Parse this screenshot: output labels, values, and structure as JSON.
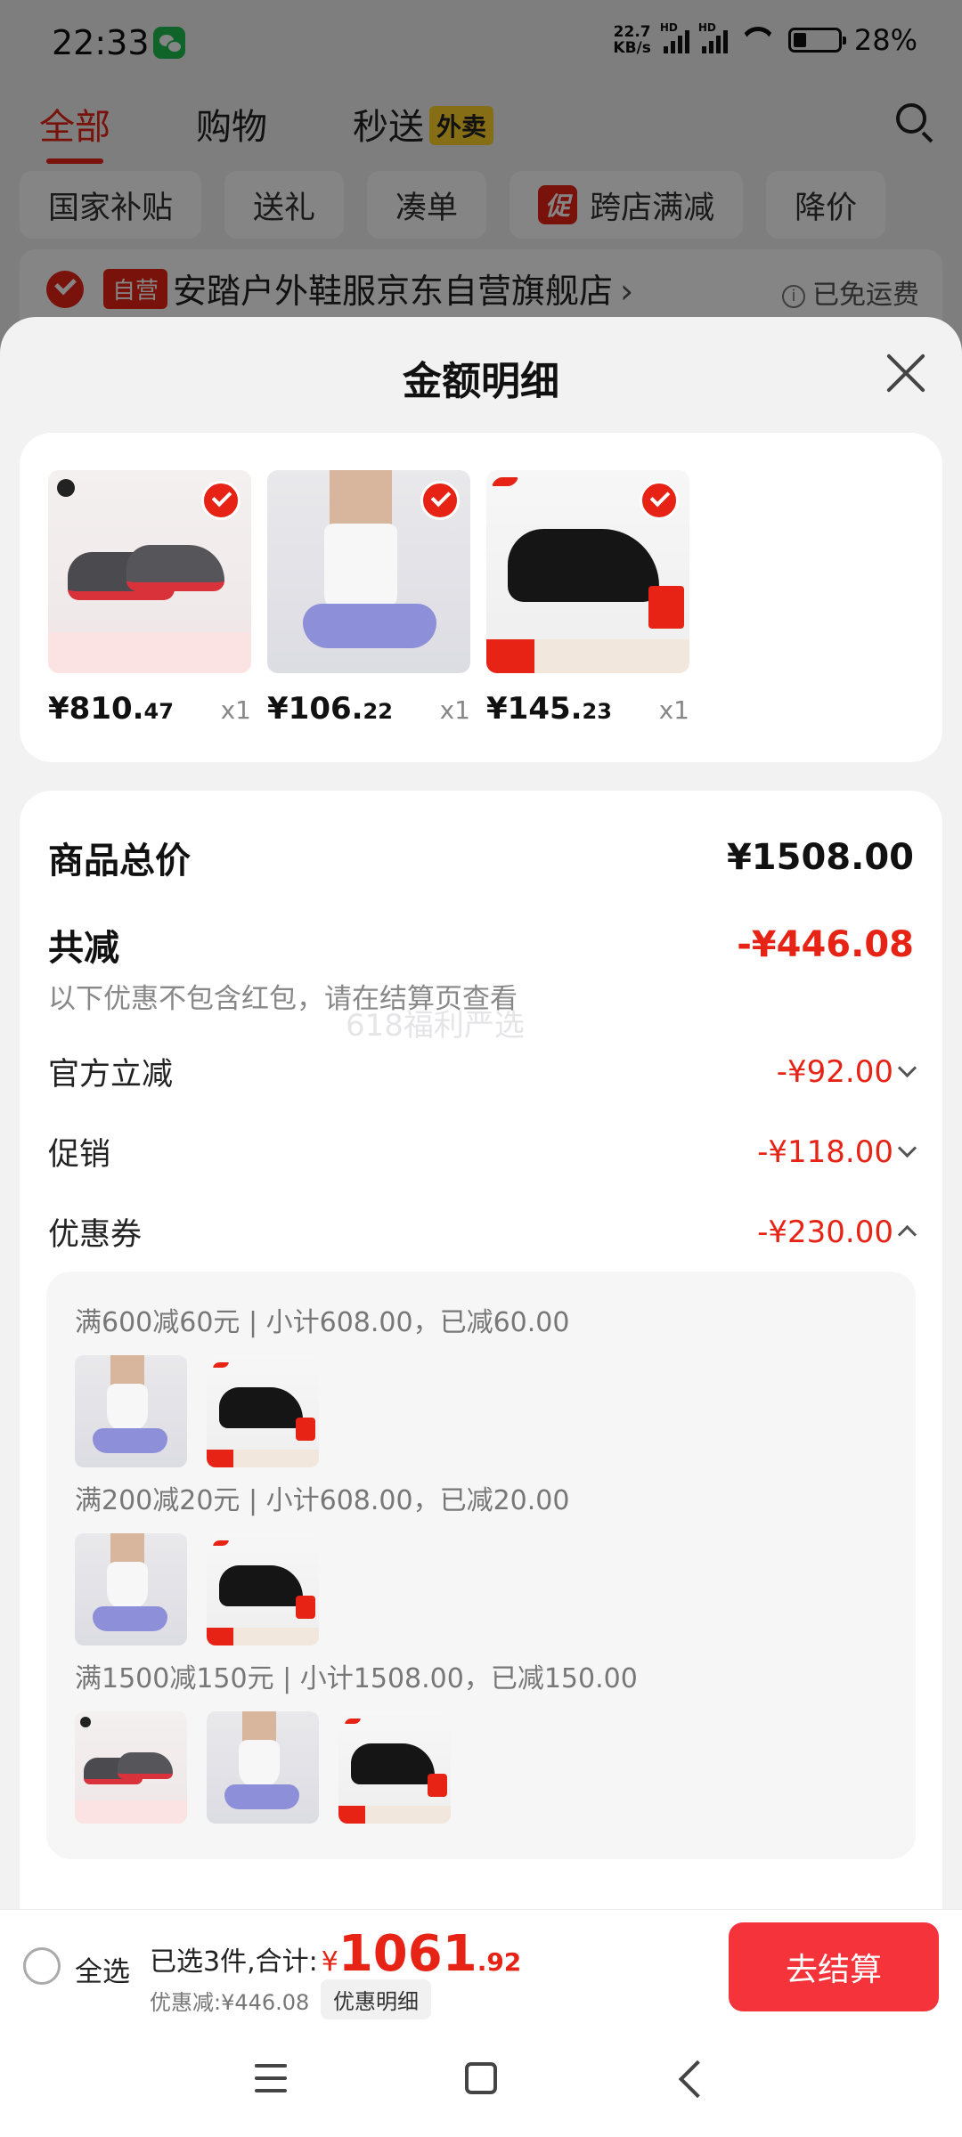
{
  "status_bar": {
    "time": "22:33",
    "net_speed_value": "22.7",
    "net_speed_unit": "KB/s",
    "signal_tag": "HD",
    "battery": "28%"
  },
  "top_tabs": {
    "all": "全部",
    "shopping": "购物",
    "express": "秒送",
    "express_badge": "外卖"
  },
  "filter_chips": [
    "国家补贴",
    "送礼",
    "凑单",
    "跨店满减",
    "降价"
  ],
  "promo_icon_text": "促",
  "store": {
    "self_badge": "自营",
    "name": "安踏户外鞋服京东自营旗舰店",
    "shipping": "已免运费",
    "info_glyph": "i"
  },
  "sheet": {
    "title": "金额明细"
  },
  "products": [
    {
      "price_int": "¥810.",
      "price_dec": "47",
      "qty": "x1"
    },
    {
      "price_int": "¥106.",
      "price_dec": "22",
      "qty": "x1"
    },
    {
      "price_int": "¥145.",
      "price_dec": "23",
      "qty": "x1"
    }
  ],
  "summary": {
    "total_label": "商品总价",
    "total_value": "¥1508.00",
    "reduce_label": "共减",
    "reduce_value": "-¥446.08",
    "note": "以下优惠不包含红包，请在结算页查看",
    "watermark": "618福利严选",
    "official_label": "官方立减",
    "official_value": "-¥92.00",
    "promo_label": "促销",
    "promo_value": "-¥118.00",
    "coupon_label": "优惠券",
    "coupon_value": "-¥230.00"
  },
  "coupons": [
    {
      "text": "满600减60元 | 小计608.00，已减60.00"
    },
    {
      "text": "满200减20元 | 小计608.00，已减20.00"
    },
    {
      "text": "满1500减150元 | 小计1508.00，已减150.00"
    }
  ],
  "checkout": {
    "select_all": "全选",
    "selected_text": "已选3件,合计:",
    "currency": "¥",
    "total_int": "1061",
    "total_dec": ".92",
    "discount": "优惠减:¥446.08",
    "detail_button": "优惠明细",
    "submit": "去结算"
  },
  "colors": {
    "accent": "#e62315",
    "checkout_button": "#f4333a",
    "express_badge": "#ffd42a"
  }
}
